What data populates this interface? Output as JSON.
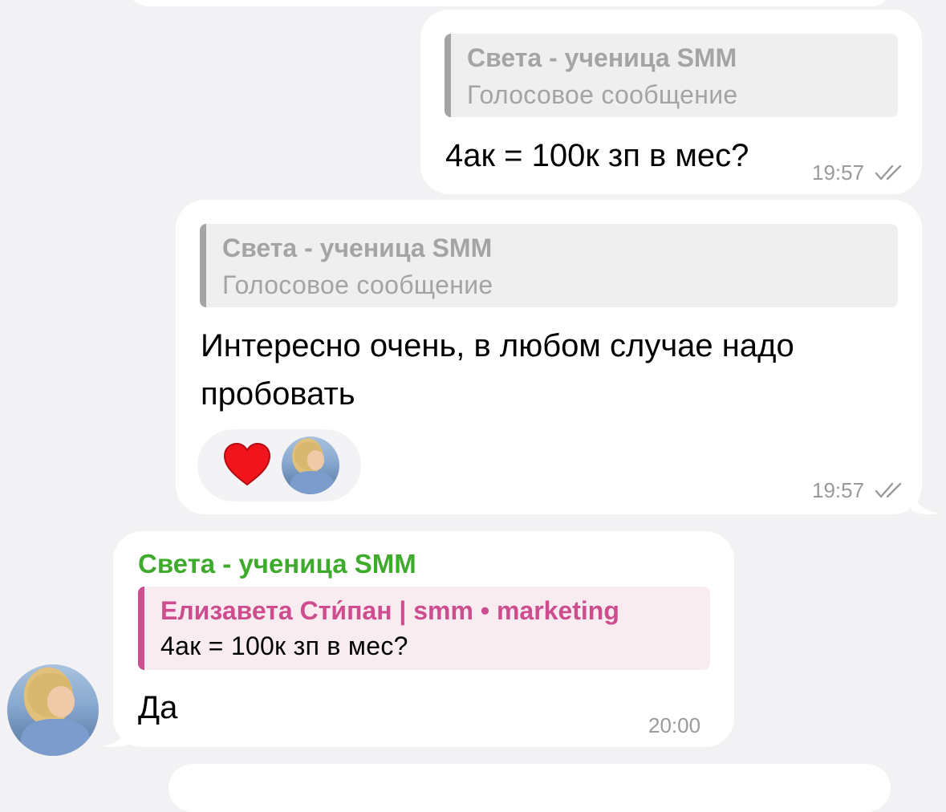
{
  "messages": [
    {
      "reply_to": {
        "name": "Света - ученица SMM",
        "text": "Голосовое сообщение"
      },
      "text": "4ак = 100к зп в мес?",
      "time": "19:57"
    },
    {
      "reply_to": {
        "name": "Света - ученица SMM",
        "text": "Голосовое сообщение"
      },
      "text": "Интересно очень, в любом случае надо пробовать",
      "reaction": {
        "emoji": "heart-icon"
      },
      "time": "19:57"
    },
    {
      "sender": "Света - ученица SMM",
      "reply_to": {
        "name": "Елизавета Сти́пан | smm • marketing",
        "text": "4ак = 100к зп в мес?"
      },
      "text": "Да",
      "time": "20:00"
    }
  ],
  "colors": {
    "background": "#f2f2f4",
    "bubble": "#ffffff",
    "sender_name": "#3fab2c",
    "quote_gray": "#a4a4a6",
    "quote_pink": "#cd4d8e",
    "reaction_heart": "#f2141c",
    "timestamp": "#9a9a9c"
  }
}
